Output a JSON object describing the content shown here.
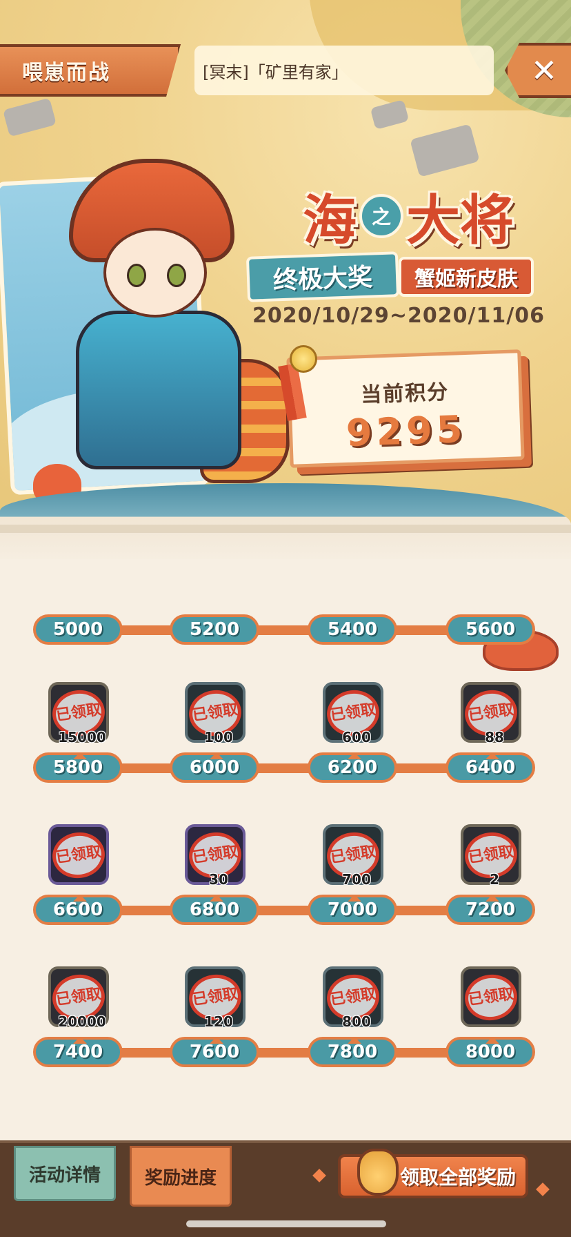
{
  "header": {
    "tab_title": "喂崽而战",
    "notice": "[冥末]「矿里有家」",
    "close_label": "✕"
  },
  "event": {
    "title_part1": "海",
    "title_connector": "之",
    "title_part2": "大将",
    "grand_prize_label": "终极大奖",
    "grand_prize_item": "蟹姬新皮肤",
    "date_range": "2020/10/29~2020/11/06"
  },
  "score": {
    "label": "当前积分",
    "value": "9295"
  },
  "rewards": {
    "row0": [
      {
        "threshold": "5000"
      },
      {
        "threshold": "5200"
      },
      {
        "threshold": "5400"
      },
      {
        "threshold": "5600"
      }
    ],
    "row1": [
      {
        "threshold": "5800",
        "qty": "15000",
        "status": "已领取"
      },
      {
        "threshold": "6000",
        "qty": "100",
        "status": "已领取"
      },
      {
        "threshold": "6200",
        "qty": "600",
        "status": "已领取"
      },
      {
        "threshold": "6400",
        "qty": "88",
        "status": "已领取"
      }
    ],
    "row2": [
      {
        "threshold": "6600",
        "qty": "",
        "status": "已领取"
      },
      {
        "threshold": "6800",
        "qty": "30",
        "status": "已领取"
      },
      {
        "threshold": "7000",
        "qty": "700",
        "status": "已领取"
      },
      {
        "threshold": "7200",
        "qty": "2",
        "status": "已领取"
      }
    ],
    "row3": [
      {
        "threshold": "7400",
        "qty": "20000",
        "status": "已领取"
      },
      {
        "threshold": "7600",
        "qty": "120",
        "status": "已领取"
      },
      {
        "threshold": "7800",
        "qty": "800",
        "status": "已领取"
      },
      {
        "threshold": "8000",
        "qty": "",
        "status": "已领取"
      }
    ]
  },
  "bottom": {
    "details_tab": "活动详情",
    "progress_tab": "奖励进度",
    "claim_all": "领取全部奖励"
  },
  "icons": {
    "close": "close-icon",
    "claim_bag": "reward-bag-icon",
    "stamp": "claimed-stamp"
  },
  "colors": {
    "accent_orange": "#e37d44",
    "pill_teal": "#4a9aa5",
    "stamp_red": "#d43b2a",
    "bottom_brown": "#5a3d2a"
  }
}
